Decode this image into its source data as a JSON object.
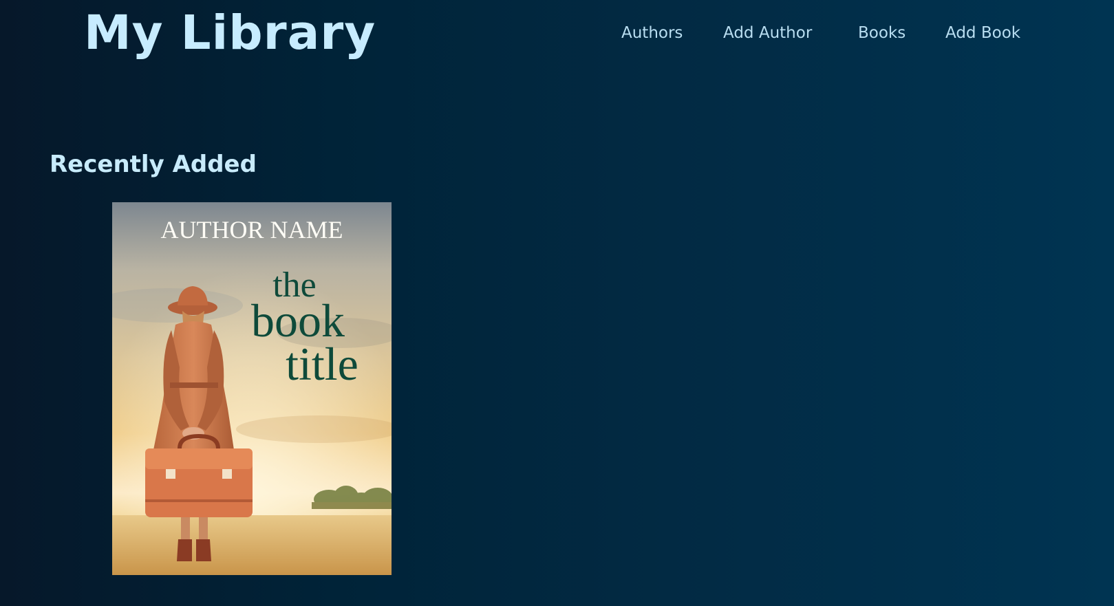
{
  "header": {
    "title": "My Library"
  },
  "nav": {
    "authors": "Authors",
    "add_author": "Add Author",
    "books": "Books",
    "add_book": "Add Book"
  },
  "main": {
    "section_title": "Recently Added",
    "books": [
      {
        "cover_author": "AUTHOR NAME",
        "cover_title_line1": "the",
        "cover_title_line2": "book",
        "cover_title_line3": "title"
      }
    ]
  },
  "colors": {
    "background_dark": "#06182a",
    "background_light": "#003452",
    "accent_text": "#c7ecff",
    "nav_text": "#b9def1",
    "cover_title_green": "#0e4a3a"
  }
}
